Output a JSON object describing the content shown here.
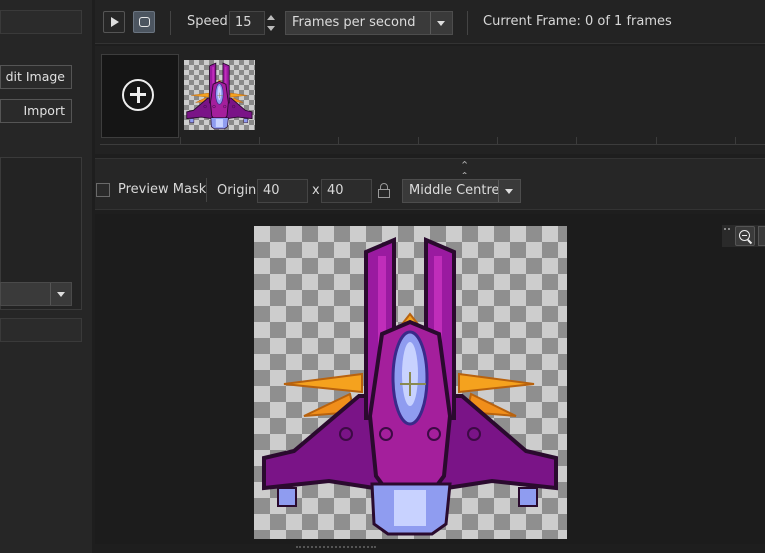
{
  "left_panel": {
    "edit_image_label": "dit Image",
    "import_label": "Import"
  },
  "toolbar": {
    "speed_label": "Speed:",
    "speed_value": "15",
    "speed_unit": "Frames per second",
    "current_frame": "Current Frame: 0 of 1 frames"
  },
  "frames": {
    "count": 1
  },
  "mask": {
    "preview_mask_label": "Preview Mask",
    "origin_label": "Origin:",
    "origin_x": "40",
    "separator": "x",
    "origin_y": "40",
    "origin_preset": "Middle Centre"
  },
  "icons": {
    "play": "play-icon",
    "loop": "loop-icon",
    "add_frame": "add-frame-icon",
    "collapse": "chevron-up-icon",
    "lock": "lock-icon",
    "zoom_out": "zoom-out-icon",
    "zoom_reset": "zoom-reset-icon"
  },
  "colors": {
    "ship_purple": "#7a1487",
    "ship_magenta": "#b01ea8",
    "ship_orange": "#f5a21e",
    "ship_blue": "#8f9cf0",
    "outline": "#2a0a2e"
  }
}
